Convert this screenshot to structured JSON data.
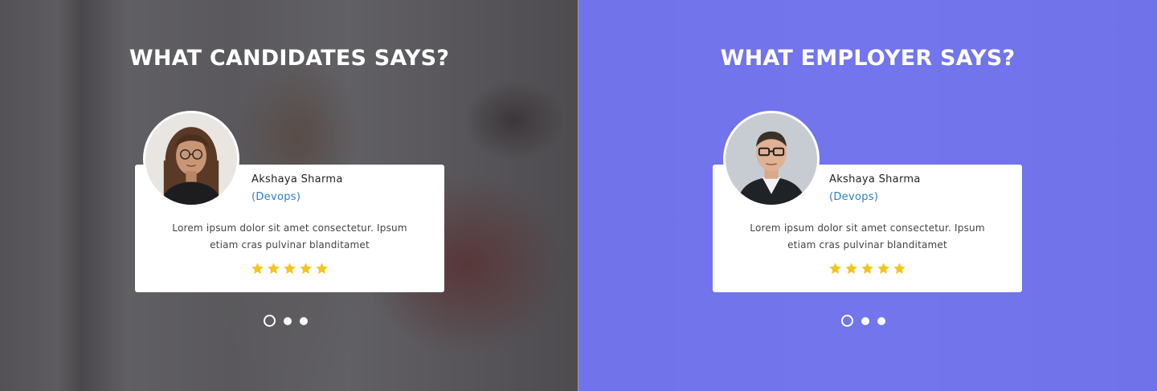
{
  "colors": {
    "left_overlay": "#28283a",
    "right_overlay": "#6264eb",
    "card_bg": "#ffffff",
    "role_text": "#2f7fc4",
    "star": "#f5c518"
  },
  "candidates": {
    "heading": "WHAT CANDIDATES SAYS?",
    "testimonial": {
      "name": "Akshaya Sharma",
      "role": "(Devops)",
      "quote_line1": "Lorem ipsum dolor sit amet consectetur. Ipsum",
      "quote_line2": "etiam cras pulvinar blanditamet",
      "rating": 5,
      "rating_max": 5,
      "avatar_icon": "woman-portrait"
    },
    "slider": {
      "count": 3,
      "active": 1
    }
  },
  "employer": {
    "heading": "WHAT EMPLOYER SAYS?",
    "testimonial": {
      "name": "Akshaya Sharma",
      "role": "(Devops)",
      "quote_line1": "Lorem ipsum dolor sit amet consectetur. Ipsum",
      "quote_line2": "etiam cras pulvinar blanditamet",
      "rating": 5,
      "rating_max": 5,
      "avatar_icon": "man-portrait"
    },
    "slider": {
      "count": 3,
      "active": 1
    }
  }
}
